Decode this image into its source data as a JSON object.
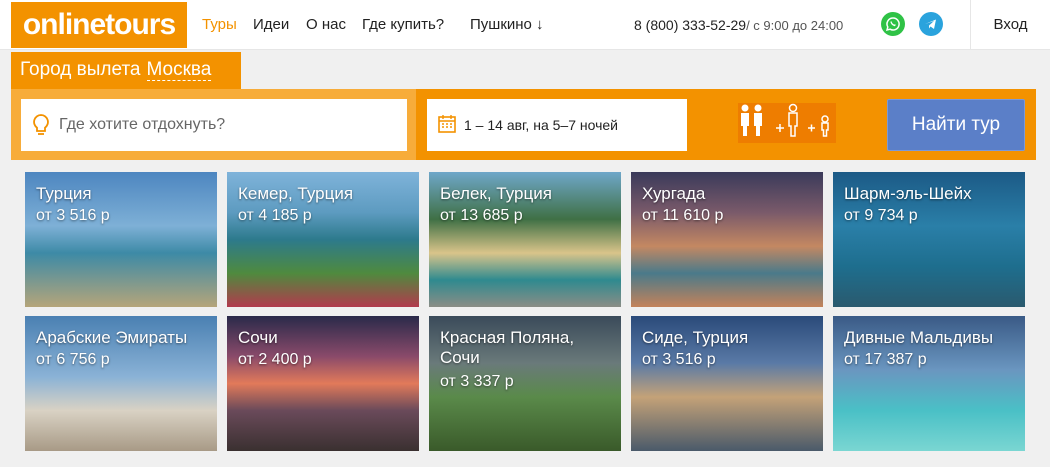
{
  "header": {
    "logo": "onlinetours",
    "nav": [
      "Туры",
      "Идеи",
      "О нас",
      "Где купить?",
      "Пушкино ↓"
    ],
    "phone": "8 (800) 333-52-29",
    "hours": "/ с 9:00 до 24:00",
    "login": "Вход",
    "colors": {
      "accent": "#f39200",
      "whatsapp": "#2fc246",
      "telegram": "#2aa3dd"
    }
  },
  "search": {
    "departure_label": "Город вылета",
    "departure_city": "Москва",
    "destination_placeholder": "Где хотите отдохнуть?",
    "dates": "1 – 14 авг, на 5–7 ночей",
    "submit": "Найти тур",
    "button_color": "#5b7fc8"
  },
  "destinations": [
    {
      "name": "Турция",
      "price": "от 3 516 р"
    },
    {
      "name": "Кемер, Турция",
      "price": "от 4 185 р"
    },
    {
      "name": "Белек, Турция",
      "price": "от 13 685 р"
    },
    {
      "name": "Хургада",
      "price": "от 11 610 р"
    },
    {
      "name": "Шарм-эль-Шейх",
      "price": "от 9 734 р"
    },
    {
      "name": "Арабские Эмираты",
      "price": "от 6 756 р"
    },
    {
      "name": "Сочи",
      "price": "от 2 400 р"
    },
    {
      "name": "Красная Поляна, Сочи",
      "price": "от 3 337 р"
    },
    {
      "name": "Сиде, Турция",
      "price": "от 3 516 р"
    },
    {
      "name": "Дивные Мальдивы",
      "price": "от 17 387 р"
    }
  ]
}
